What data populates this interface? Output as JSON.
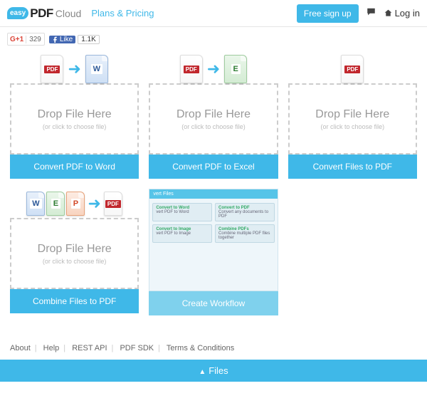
{
  "header": {
    "logo": {
      "easy": "easy",
      "pdf": "PDF",
      "cloud": "Cloud"
    },
    "nav": {
      "plans": "Plans & Pricing"
    },
    "signup": "Free sign up",
    "login": "Log in"
  },
  "social": {
    "gplus_count": "329",
    "fb_label": "Like",
    "fb_count": "1.1K"
  },
  "cards": [
    {
      "drop_title": "Drop File Here",
      "drop_sub": "(or click to choose file)",
      "button": "Convert PDF to Word"
    },
    {
      "drop_title": "Drop File Here",
      "drop_sub": "(or click to choose file)",
      "button": "Convert PDF to Excel"
    },
    {
      "drop_title": "Drop File Here",
      "drop_sub": "(or click to choose file)",
      "button": "Convert Files to PDF"
    },
    {
      "drop_title": "Drop File Here",
      "drop_sub": "(or click to choose file)",
      "button": "Combine Files to PDF"
    },
    {
      "button": "Create Workflow"
    }
  ],
  "workflow_thumb": {
    "header": "vert Files",
    "boxes": [
      {
        "title": "Convert to Word",
        "sub": "vert PDF to Word"
      },
      {
        "title": "Convert to PDF",
        "sub": "Convert any documents to PDF"
      },
      {
        "title": "Convert to Image",
        "sub": "vert PDF to Image"
      },
      {
        "title": "Combine PDFs",
        "sub": "Combine multiple PDF files together"
      }
    ]
  },
  "footer": {
    "links": [
      "About",
      "Help",
      "REST API",
      "PDF SDK",
      "Terms & Conditions"
    ],
    "files_bar": "Files"
  },
  "icons": {
    "pdf_label": "PDF",
    "word_label": "W",
    "excel_label": "E",
    "ppt_label": "P"
  }
}
